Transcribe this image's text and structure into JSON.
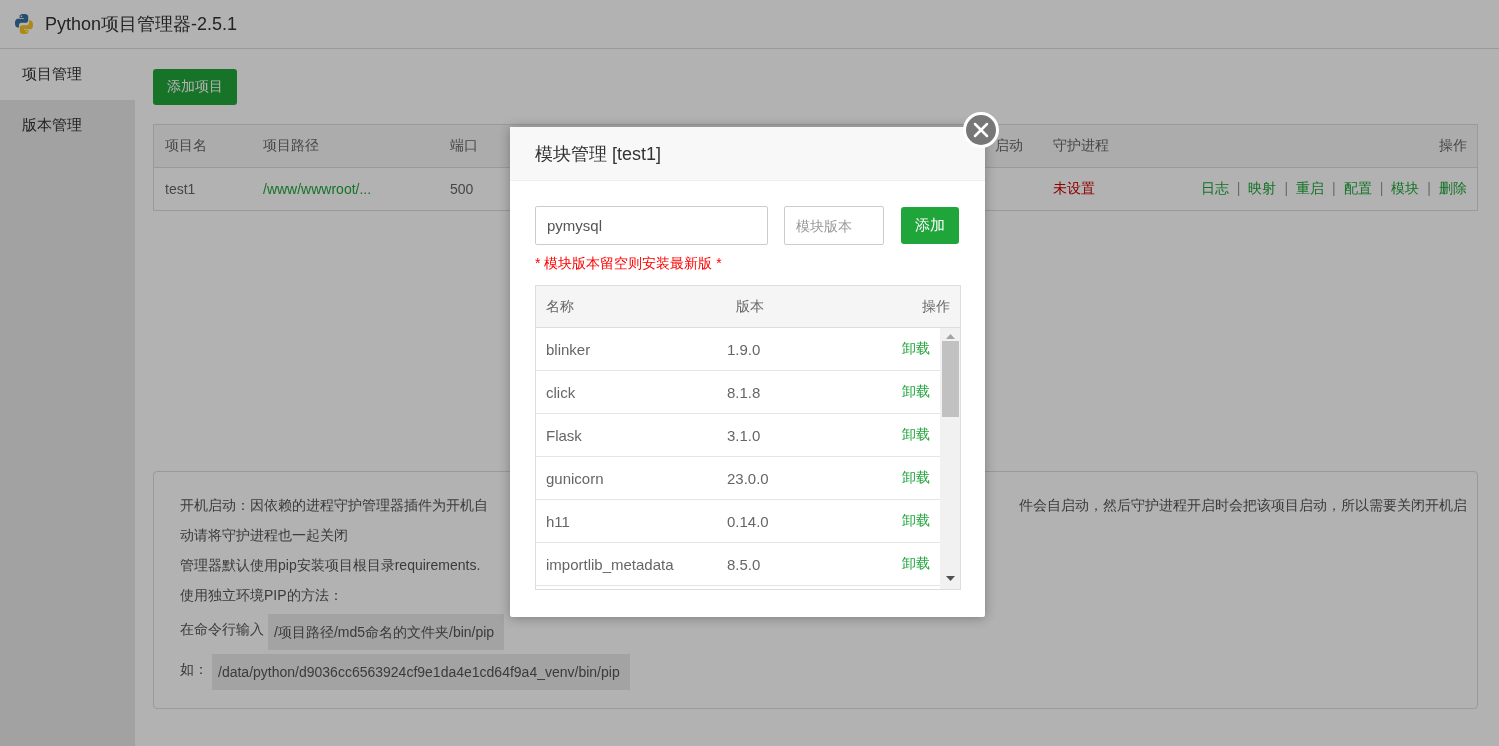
{
  "window": {
    "title": "Python项目管理器-2.5.1"
  },
  "sidebar": {
    "items": [
      {
        "label": "项目管理",
        "selected": true
      },
      {
        "label": "版本管理",
        "selected": false
      }
    ]
  },
  "add_project_button": "添加项目",
  "projects_table": {
    "columns": [
      "项目名",
      "项目路径",
      "端口",
      "启动",
      "守护进程",
      "操作"
    ],
    "rows": [
      {
        "name": "test1",
        "path": "/www/wwwroot/...",
        "port": "500",
        "daemon": "未设置",
        "daemon_set": false,
        "actions": [
          "日志",
          "映射",
          "重启",
          "配置",
          "模块",
          "删除"
        ],
        "separator": "|"
      }
    ]
  },
  "notes": {
    "line_1_left": "开机启动：因依赖的进程守护管理器插件为开机自",
    "line_1_right": "件会自启动，然后守护进程开启时会把该项目启动，所以需要关闭开机启",
    "lines": [
      "动请将守护进程也一起关闭",
      "管理器默认使用pip安装项目根目录requirements.",
      "使用独立环境PIP的方法："
    ],
    "code_lines": [
      {
        "label": "在命令行输入",
        "code": "/项目路径/md5命名的文件夹/bin/pip"
      },
      {
        "label": "如：",
        "code": "/data/python/d9036cc6563924cf9e1da4e1cd64f9a4_venv/bin/pip"
      }
    ]
  },
  "dialog": {
    "title": "模块管理 [test1]",
    "module_field": {
      "value": "pymysql"
    },
    "version_field": {
      "placeholder": "模块版本"
    },
    "add_button": "添加",
    "hint": "* 模块版本留空则安装最新版 *",
    "columns": [
      "名称",
      "版本",
      "操作"
    ],
    "modules": [
      {
        "name": "blinker",
        "version": "1.9.0",
        "action": "卸载"
      },
      {
        "name": "click",
        "version": "8.1.8",
        "action": "卸载"
      },
      {
        "name": "Flask",
        "version": "3.1.0",
        "action": "卸载"
      },
      {
        "name": "gunicorn",
        "version": "23.0.0",
        "action": "卸载"
      },
      {
        "name": "h11",
        "version": "0.14.0",
        "action": "卸载"
      },
      {
        "name": "importlib_metadata",
        "version": "8.5.0",
        "action": "卸载"
      }
    ]
  }
}
